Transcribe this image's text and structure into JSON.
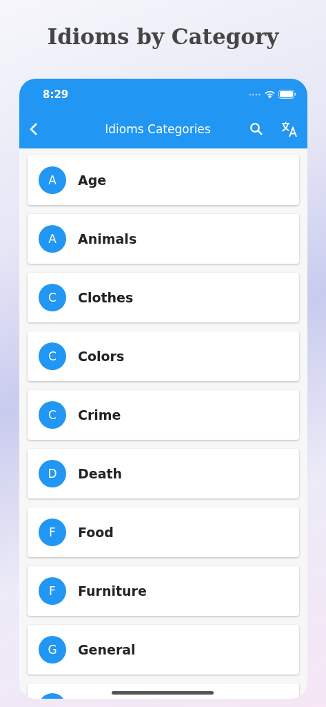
{
  "headline": "Idioms by Category",
  "status_bar": {
    "time": "8:29"
  },
  "app_bar": {
    "title": "Idioms Categories"
  },
  "categories": [
    {
      "letter": "A",
      "name": "Age"
    },
    {
      "letter": "A",
      "name": "Animals"
    },
    {
      "letter": "C",
      "name": "Clothes"
    },
    {
      "letter": "C",
      "name": "Colors"
    },
    {
      "letter": "C",
      "name": "Crime"
    },
    {
      "letter": "D",
      "name": "Death"
    },
    {
      "letter": "F",
      "name": "Food"
    },
    {
      "letter": "F",
      "name": "Furniture"
    },
    {
      "letter": "G",
      "name": "General"
    }
  ]
}
